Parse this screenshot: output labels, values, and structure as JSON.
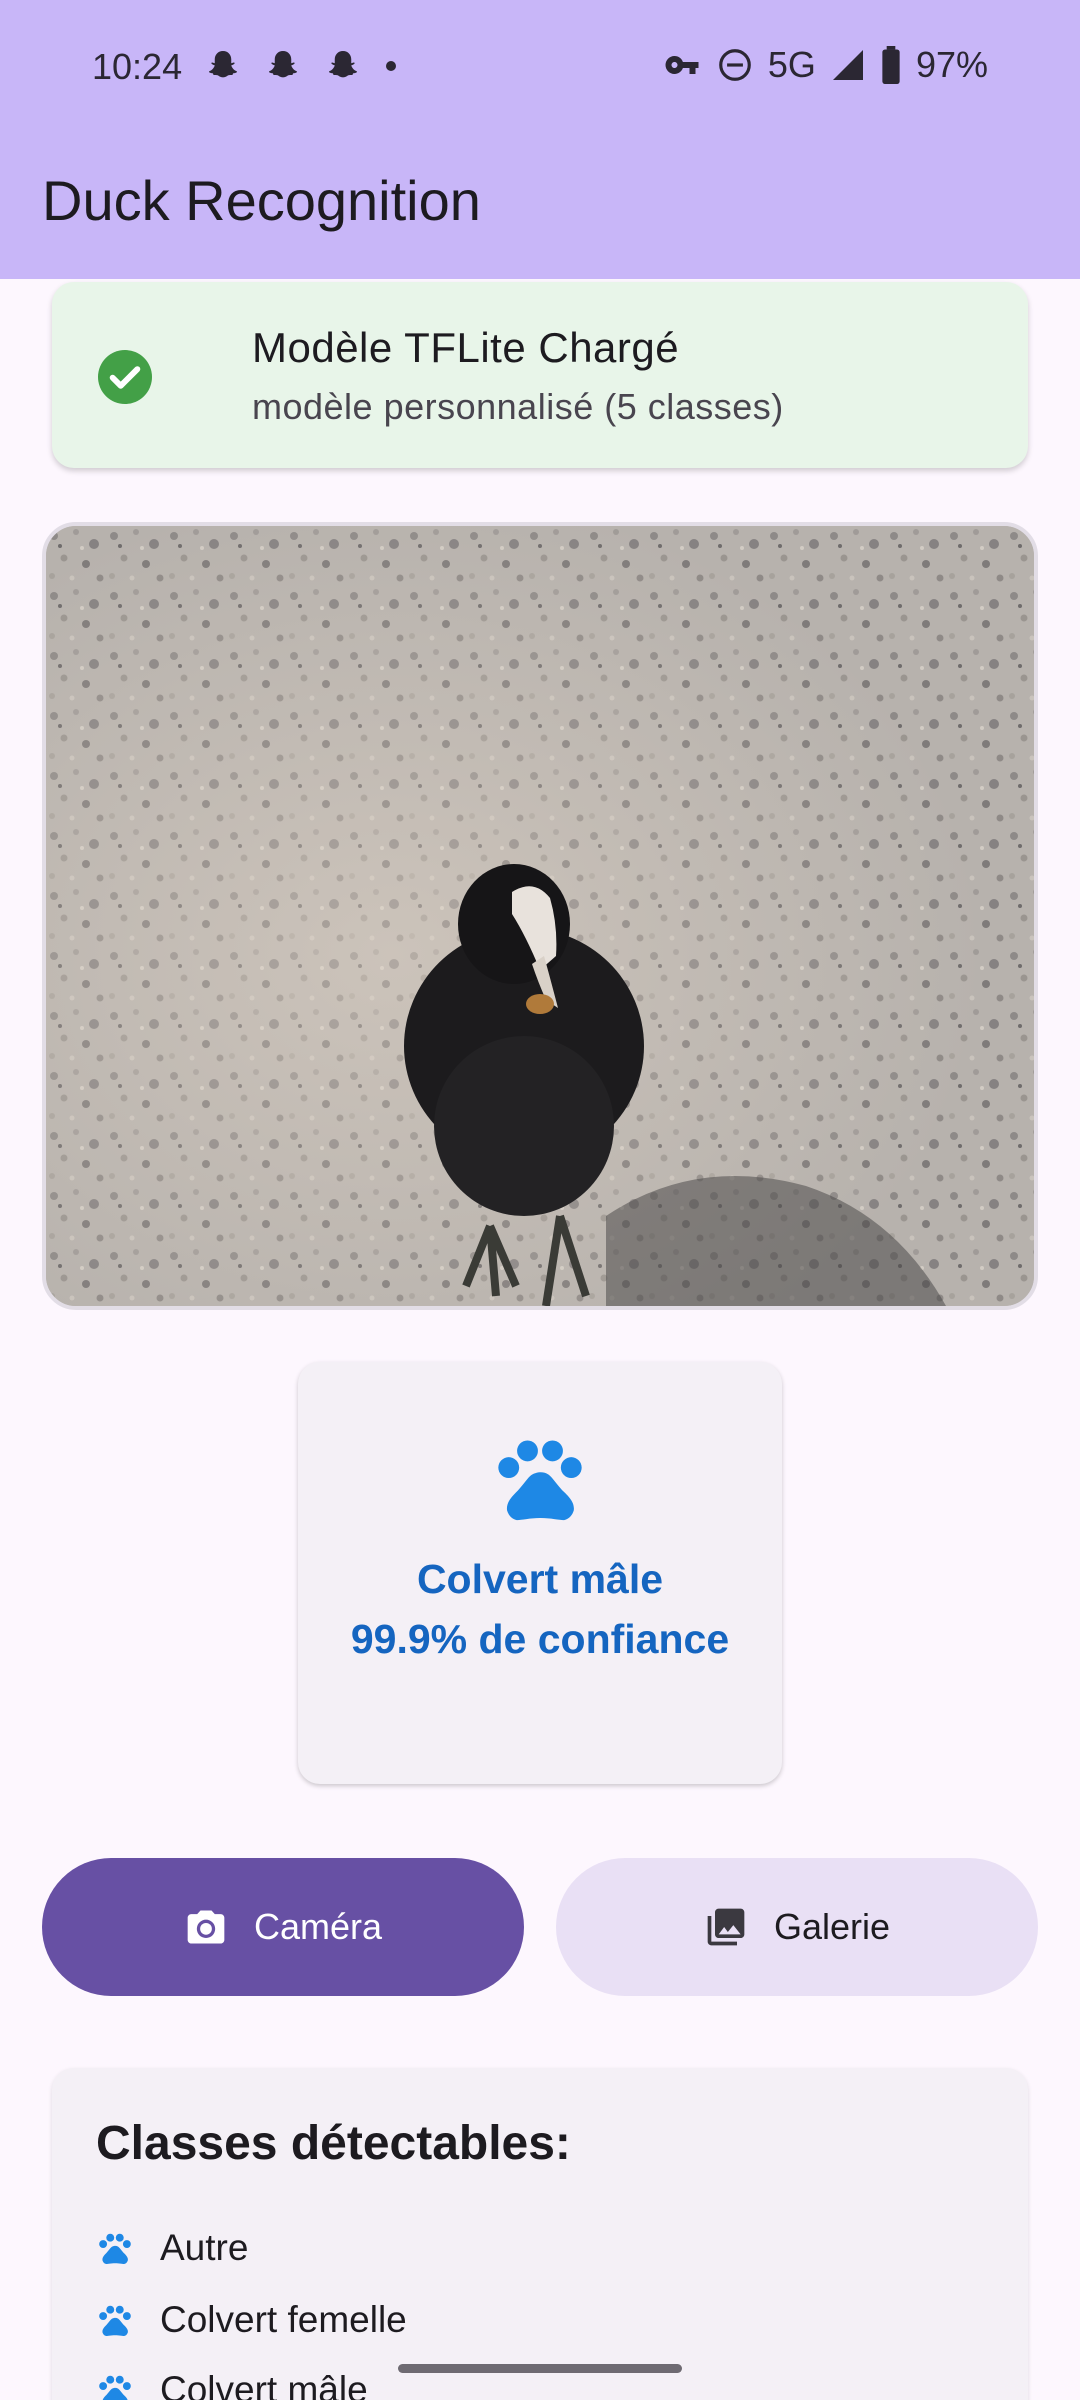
{
  "status_bar": {
    "time": "10:24",
    "notification_icons": [
      "snapchat-ghost-icon",
      "snapchat-ghost-icon",
      "snapchat-ghost-icon",
      "dot-icon"
    ],
    "network": "5G",
    "battery": "97%"
  },
  "app_bar": {
    "title": "Duck Recognition"
  },
  "model_status": {
    "title": "Modèle TFLite Chargé",
    "subtitle": "modèle personnalisé (5 classes)",
    "icon": "check-circle-icon",
    "color": "#43a047"
  },
  "result": {
    "label": "Colvert mâle",
    "confidence": "99.9% de confiance",
    "icon": "paw-icon",
    "color": "#1565c0"
  },
  "buttons": {
    "camera": {
      "label": "Caméra",
      "icon": "camera-icon"
    },
    "gallery": {
      "label": "Galerie",
      "icon": "gallery-icon"
    }
  },
  "classes": {
    "heading": "Classes détectables:",
    "items": [
      "Autre",
      "Colvert femelle",
      "Colvert mâle"
    ]
  },
  "colors": {
    "app_bar": "#c8b6f8",
    "primary": "#6750a4",
    "secondary_container": "#e9e0f5",
    "paw": "#1e88e5"
  }
}
